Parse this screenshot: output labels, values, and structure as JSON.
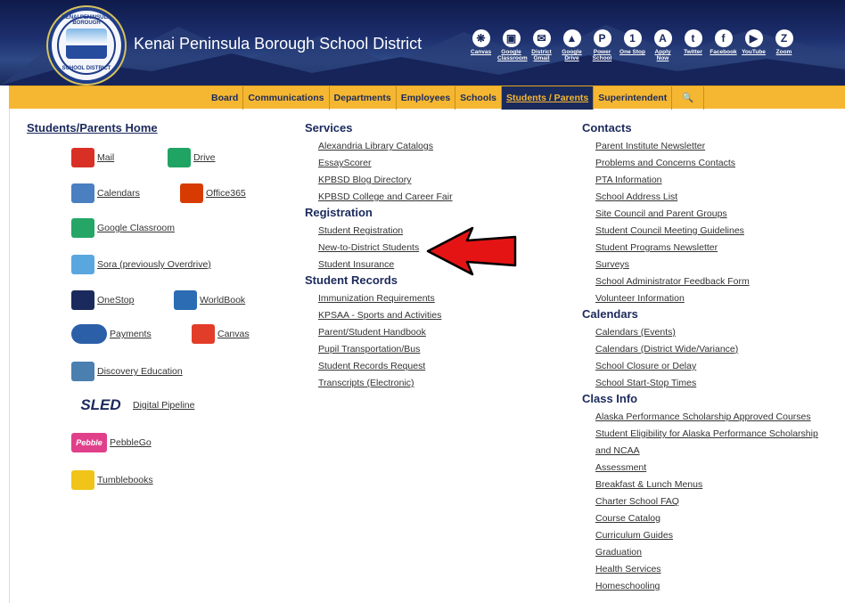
{
  "header": {
    "logo_top": "KENAI PENINSULA BOROUGH",
    "logo_bottom": "SCHOOL DISTRICT",
    "title": "Kenai Peninsula Borough School District",
    "toplinks": [
      {
        "label1": "Canvas",
        "label2": "",
        "icon": "canvas-icon",
        "glyph": "❋"
      },
      {
        "label1": "Google",
        "label2": "Classroom",
        "icon": "classroom-icon",
        "glyph": "▣"
      },
      {
        "label1": "District",
        "label2": "Gmail",
        "icon": "mail-icon",
        "glyph": "✉"
      },
      {
        "label1": "Google",
        "label2": "Drive",
        "icon": "drive-icon",
        "glyph": "▲"
      },
      {
        "label1": "Power",
        "label2": "School",
        "icon": "powerschool-icon",
        "glyph": "P"
      },
      {
        "label1": "One Stop",
        "label2": "",
        "icon": "onestop-icon",
        "glyph": "1"
      },
      {
        "label1": "Apply",
        "label2": "Now",
        "icon": "apply-icon",
        "glyph": "A"
      },
      {
        "label1": "Twitter",
        "label2": "",
        "icon": "twitter-icon",
        "glyph": "t"
      },
      {
        "label1": "Facebook",
        "label2": "",
        "icon": "facebook-icon",
        "glyph": "f"
      },
      {
        "label1": "YouTube",
        "label2": "",
        "icon": "youtube-icon",
        "glyph": "▶"
      },
      {
        "label1": "Zoom",
        "label2": "",
        "icon": "zoom-icon",
        "glyph": "Z"
      }
    ]
  },
  "nav": {
    "items": [
      "Board",
      "Communications",
      "Departments",
      "Employees",
      "Schools",
      "Students / Parents",
      "Superintendent"
    ],
    "active": "Students / Parents",
    "search_glyph": "🔍"
  },
  "left": {
    "heading": "Students/Parents Home",
    "apps": [
      {
        "label": "Mail",
        "icon": "gmail-icon",
        "color": "#d93025"
      },
      {
        "label": "Drive",
        "icon": "google-drive-icon",
        "color": "#1fa463"
      },
      {
        "label": "Calendars",
        "icon": "calendar-icon",
        "color": "#4a7fc1"
      },
      {
        "label": "Office365",
        "icon": "office365-icon",
        "color": "#d83b01"
      },
      {
        "label": "Google Classroom",
        "icon": "google-classroom-icon",
        "color": "#25a667"
      },
      {
        "label": "Sora (previously Overdrive)",
        "icon": "sora-icon",
        "color": "#5aa7e0"
      },
      {
        "label": "OneStop",
        "icon": "onestop-logo-icon",
        "color": "#1b2a5c"
      },
      {
        "label": "WorldBook",
        "icon": "worldbook-icon",
        "color": "#2b6cb3"
      },
      {
        "label": "Payments",
        "icon": "online-payments-icon",
        "color": "#2b5fa8"
      },
      {
        "label": "Canvas",
        "icon": "canvas-logo-icon",
        "color": "#e23d28"
      },
      {
        "label": "Discovery Education",
        "icon": "discovery-icon",
        "color": "#4a7fb0"
      },
      {
        "label": "Digital Pipeline",
        "icon": "sled-icon",
        "color": "#1b2a5c",
        "badge": "SLED"
      },
      {
        "label": "PebbleGo",
        "icon": "pebblego-icon",
        "color": "#e0408a",
        "badge": "Pebble"
      },
      {
        "label": "Tumblebooks",
        "icon": "tumblebooks-icon",
        "color": "#f0c419"
      }
    ]
  },
  "middle": {
    "sections": [
      {
        "heading": "Services",
        "links": [
          "Alexandria Library Catalogs",
          "EssayScorer",
          "KPBSD Blog Directory",
          "KPBSD College and Career Fair"
        ]
      },
      {
        "heading": "Registration",
        "links": [
          "Student Registration",
          "New-to-District Students",
          "Student Insurance"
        ]
      },
      {
        "heading": "Student Records",
        "links": [
          "Immunization Requirements",
          "KPSAA - Sports and Activities",
          "Parent/Student Handbook",
          "Pupil Transportation/Bus",
          "Student Records Request",
          "Transcripts (Electronic)"
        ]
      }
    ]
  },
  "right": {
    "sections": [
      {
        "heading": "Contacts",
        "links": [
          "Parent Institute Newsletter",
          "Problems and Concerns Contacts",
          "PTA Information",
          "School Address List",
          "Site Council and Parent Groups",
          "Student Council Meeting Guidelines",
          "Student Programs Newsletter",
          "Surveys",
          "School Administrator Feedback Form",
          "Volunteer Information"
        ]
      },
      {
        "heading": "Calendars",
        "links": [
          "Calendars (Events)",
          "Calendars (District Wide/Variance)",
          "School Closure or Delay",
          "School Start-Stop Times"
        ]
      },
      {
        "heading": "Class Info",
        "links": [
          "Alaska Performance Scholarship Approved Courses",
          "Student Eligibility for Alaska Performance Scholarship",
          "and NCAA",
          "Assessment",
          "Breakfast & Lunch Menus",
          "Charter School FAQ",
          "Course Catalog",
          "Curriculum Guides",
          "Graduation",
          "Health Services",
          "Homeschooling"
        ]
      }
    ]
  },
  "colors": {
    "navy": "#1b2a5c",
    "gold": "#f5b731",
    "arrow": "#e41414"
  }
}
